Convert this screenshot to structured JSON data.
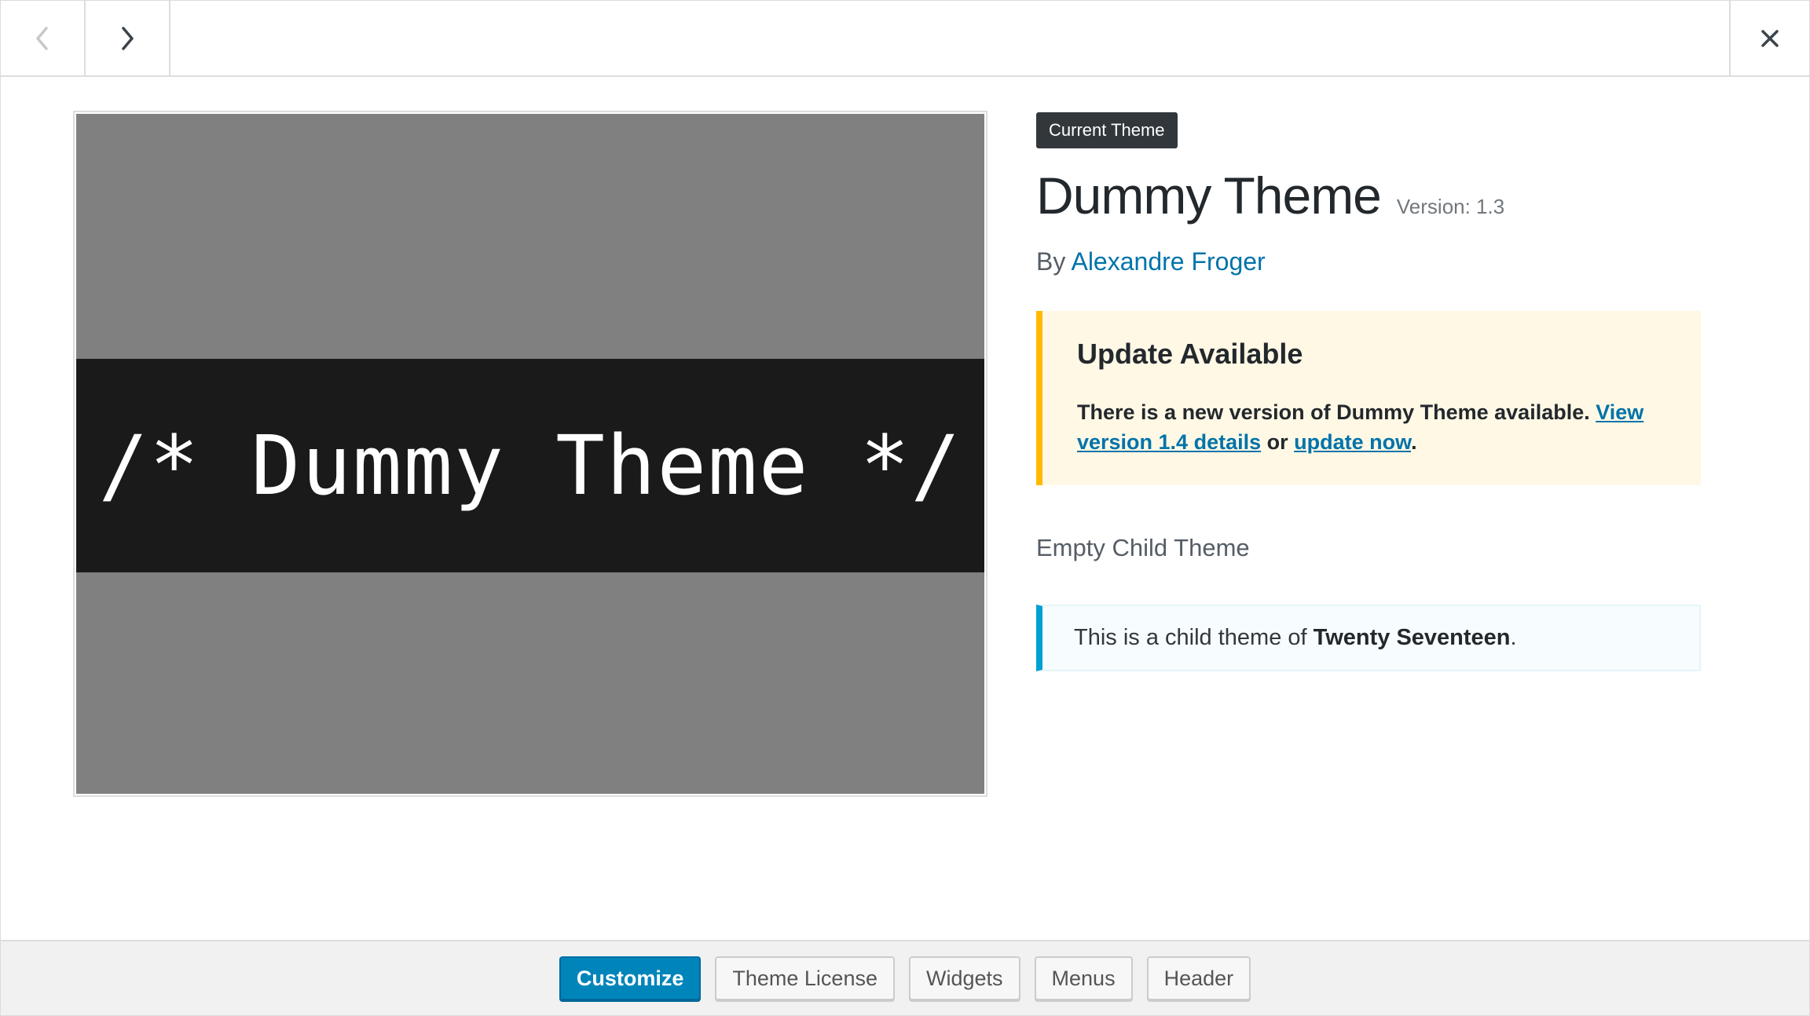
{
  "header": {
    "prev_icon": "chevron-left-icon",
    "next_icon": "chevron-right-icon",
    "close_icon": "close-icon"
  },
  "screenshot": {
    "text": "/* Dummy Theme */",
    "colors": {
      "background": "#808080",
      "band": "#1a1a1a",
      "text": "#ffffff"
    }
  },
  "theme": {
    "badge": "Current Theme",
    "name": "Dummy Theme",
    "version": "Version: 1.3",
    "author_prefix": "By",
    "author": "Alexandre Froger",
    "description": "Empty Child Theme"
  },
  "update_notice": {
    "heading": "Update Available",
    "text_before": "There is a new version of Dummy Theme available. ",
    "details_link": "View version 1.4 details",
    "text_mid": " or ",
    "update_link": "update now",
    "text_after": "."
  },
  "parent_notice": {
    "text_before": "This is a child theme of ",
    "parent_name": "Twenty Seventeen",
    "text_after": "."
  },
  "footer": {
    "customize": "Customize",
    "license": "Theme License",
    "widgets": "Widgets",
    "menus": "Menus",
    "header": "Header"
  },
  "colors": {
    "accent": "#0085ba",
    "link": "#0073aa",
    "warning": "#ffb900",
    "info": "#00a0d2"
  }
}
